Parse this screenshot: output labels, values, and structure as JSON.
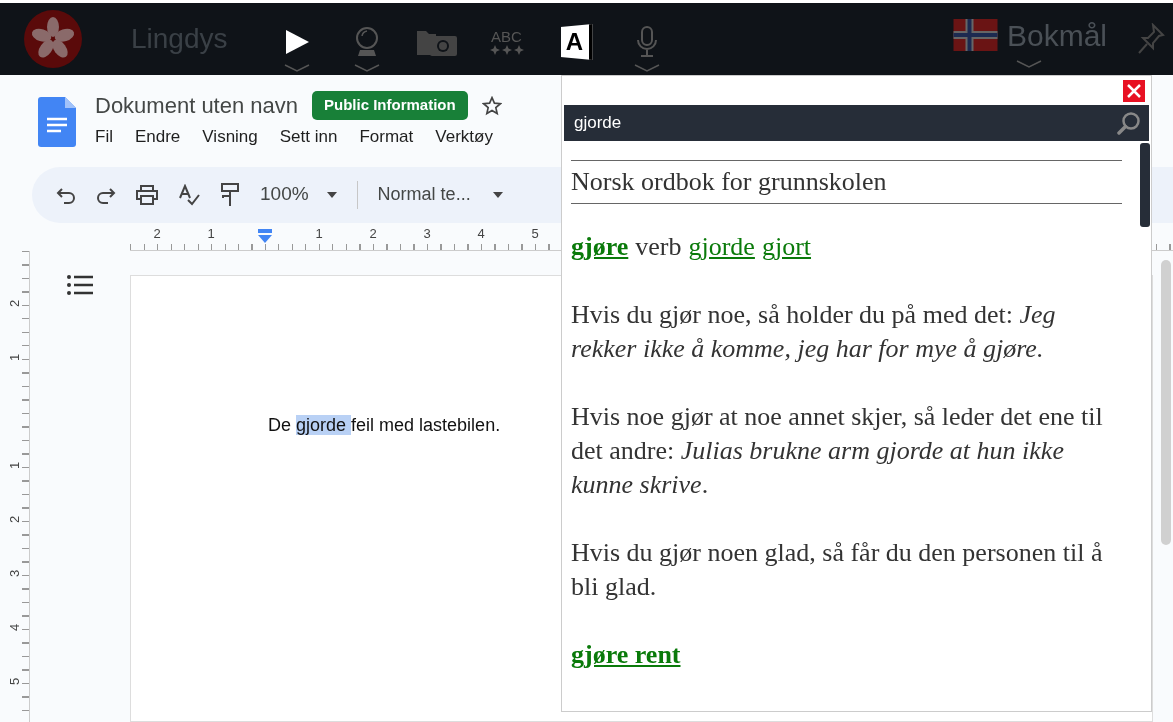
{
  "topbar": {
    "app_name": "Lingdys",
    "tools": [
      {
        "kind": "play",
        "dropdown": true
      },
      {
        "kind": "crystal-ball",
        "dropdown": true
      },
      {
        "kind": "camera",
        "dropdown": false
      },
      {
        "kind": "abc",
        "label": "ABC",
        "dropdown": false
      },
      {
        "kind": "dictionary",
        "label": "A",
        "dropdown": false
      },
      {
        "kind": "microphone",
        "dropdown": true
      }
    ],
    "language": "Bokmål"
  },
  "docs": {
    "title": "Dokument uten navn",
    "badge": "Public Information",
    "menu": [
      "Fil",
      "Endre",
      "Visning",
      "Sett inn",
      "Format",
      "Verktøy"
    ],
    "toolbar": {
      "zoom": "100%",
      "style": "Normal te..."
    },
    "ruler_h": [
      {
        "kind": "number",
        "label": "2"
      },
      {
        "kind": "number",
        "label": "1"
      },
      {
        "kind": "marker"
      },
      {
        "kind": "number",
        "label": "1"
      },
      {
        "kind": "number",
        "label": "2"
      },
      {
        "kind": "number",
        "label": "3"
      },
      {
        "kind": "number",
        "label": "4"
      },
      {
        "kind": "number",
        "label": "5"
      }
    ],
    "ruler_v": [
      {
        "kind": "number",
        "label": "2"
      },
      {
        "kind": "number",
        "label": "1"
      },
      {
        "kind": "blank"
      },
      {
        "kind": "number",
        "label": "1"
      },
      {
        "kind": "number",
        "label": "2"
      },
      {
        "kind": "number",
        "label": "3"
      },
      {
        "kind": "number",
        "label": "4"
      },
      {
        "kind": "number",
        "label": "5"
      }
    ],
    "text": [
      {
        "text": "De ",
        "selected": false
      },
      {
        "text": "gjorde ",
        "selected": true
      },
      {
        "text": "feil med lastebilen.",
        "selected": false
      }
    ]
  },
  "popup": {
    "search": "gjorde",
    "source": "Norsk ordbok for grunnskolen",
    "headword": {
      "word": "gjøre",
      "pos": "verb",
      "forms": [
        "gjorde",
        "gjort"
      ]
    },
    "senses": [
      "Hvis du gjør noe, så holder du på med det: *Jeg rekker ikke å komme, jeg har for mye å gjøre.*",
      "Hvis noe gjør at noe annet skjer, så leder det ene til det andre: *Julias brukne arm gjorde at hun ikke kunne skrive*.",
      "Hvis du gjør noen glad, så får du den personen til å bli glad."
    ],
    "subentry": "gjøre rent"
  }
}
